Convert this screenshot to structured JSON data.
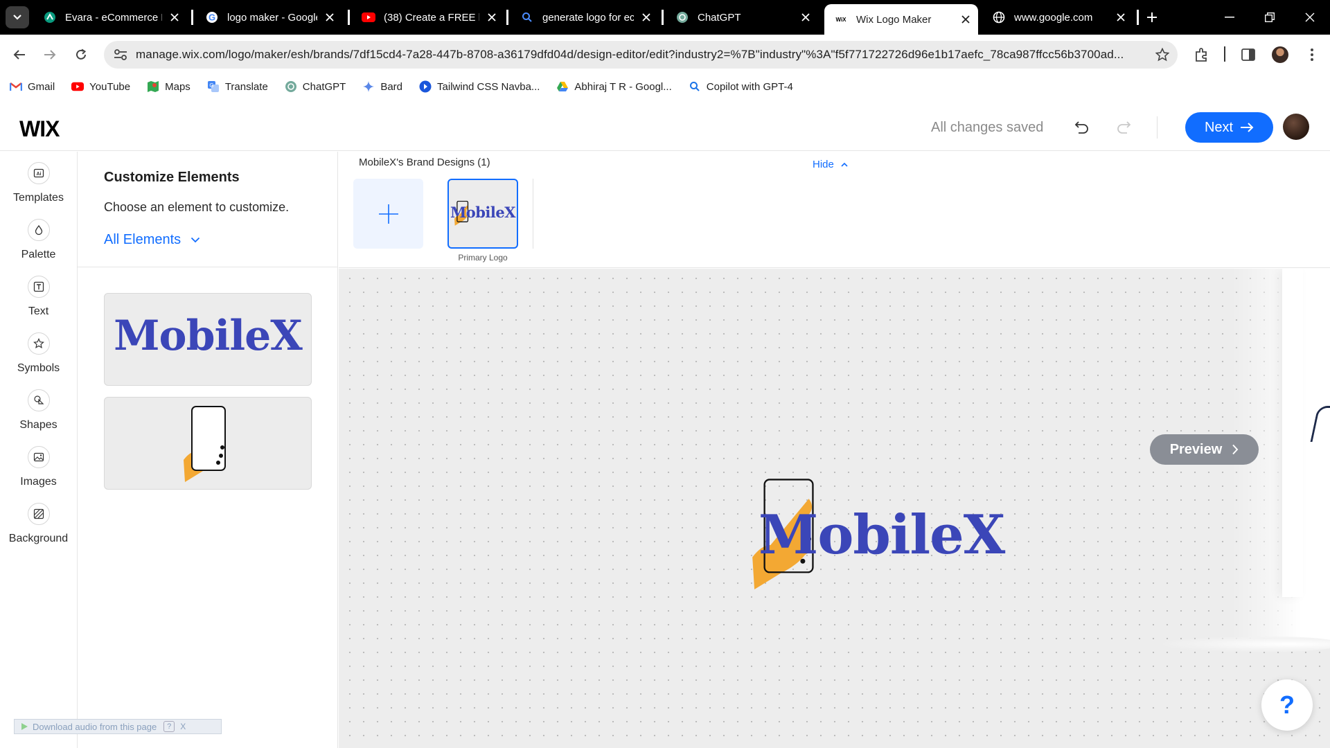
{
  "browser": {
    "tabs": [
      {
        "title": "Evara - eCommerce H",
        "icon": "evara-icon",
        "active": false
      },
      {
        "title": "logo maker - Google",
        "icon": "google-icon",
        "active": false
      },
      {
        "title": "(38) Create a FREE lo",
        "icon": "youtube-icon",
        "active": false
      },
      {
        "title": "generate logo for ec",
        "icon": "search-icon",
        "active": false
      },
      {
        "title": "ChatGPT",
        "icon": "chatgpt-icon",
        "active": false
      },
      {
        "title": "Wix Logo Maker",
        "icon": "wix-icon",
        "active": true
      },
      {
        "title": "www.google.com",
        "icon": "globe-icon",
        "active": false
      }
    ],
    "url": "manage.wix.com/logo/maker/esh/brands/7df15cd4-7a28-447b-8708-a36179dfd04d/design-editor/edit?industry2=%7B\"industry\"%3A\"f5f771722726d96e1b17aefc_78ca987ffcc56b3700ad...",
    "bookmarks": [
      {
        "label": "Gmail",
        "icon": "gmail-icon"
      },
      {
        "label": "YouTube",
        "icon": "youtube-icon"
      },
      {
        "label": "Maps",
        "icon": "maps-icon"
      },
      {
        "label": "Translate",
        "icon": "translate-icon"
      },
      {
        "label": "ChatGPT",
        "icon": "chatgpt-icon"
      },
      {
        "label": "Bard",
        "icon": "bard-icon"
      },
      {
        "label": "Tailwind CSS Navba...",
        "icon": "tailwind-icon"
      },
      {
        "label": "Abhiraj T R - Googl...",
        "icon": "drive-icon"
      },
      {
        "label": "Copilot with GPT-4",
        "icon": "search-icon"
      }
    ]
  },
  "header": {
    "logo": "WIX",
    "status": "All changes saved",
    "next_label": "Next",
    "accent": "#116dff"
  },
  "rail": {
    "items": [
      {
        "label": "Templates",
        "icon": "templates-icon"
      },
      {
        "label": "Palette",
        "icon": "palette-icon"
      },
      {
        "label": "Text",
        "icon": "text-icon"
      },
      {
        "label": "Symbols",
        "icon": "symbols-icon"
      },
      {
        "label": "Shapes",
        "icon": "shapes-icon"
      },
      {
        "label": "Images",
        "icon": "images-icon"
      },
      {
        "label": "Background",
        "icon": "background-icon"
      }
    ]
  },
  "panel": {
    "title": "Customize Elements",
    "subtitle": "Choose an element to customize.",
    "filter_label": "All Elements",
    "wordmark": "MobileX",
    "brand_color": "#3b46b8",
    "symbol_color": "#f3a833"
  },
  "brand": {
    "title": "MobileX's Brand Designs (1)",
    "hide_label": "Hide",
    "thumb_text": "MobileX",
    "thumb_label": "Primary Logo"
  },
  "canvas": {
    "logo_text": "MobileX",
    "preview_label": "Preview",
    "help_label": "?"
  },
  "extension": {
    "download_label": "Download audio from this page",
    "help": "?",
    "close": "X"
  }
}
